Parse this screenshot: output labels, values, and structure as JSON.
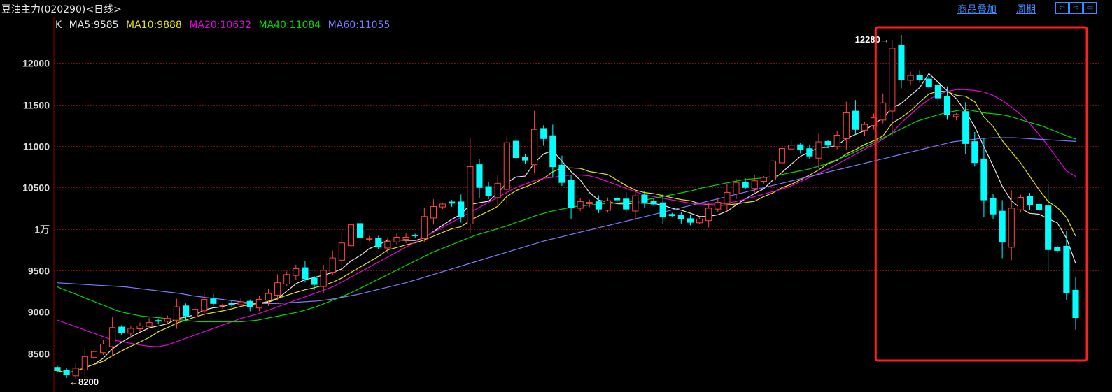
{
  "header": {
    "title": "豆油主力(020290)<日线>",
    "overlay_link": "商品叠加",
    "period_link": "周期",
    "ctrl_icons": [
      "arrow-left-icon",
      "arrow-right-icon",
      "window-icon"
    ],
    "ctrl_glyphs": [
      "⇦",
      "⇨",
      "▭"
    ]
  },
  "legend": [
    {
      "label": "K",
      "color": "#e0e0e0"
    },
    {
      "label": "MA5:9585",
      "color": "#e8e8e8"
    },
    {
      "label": "MA10:9888",
      "color": "#e6e600"
    },
    {
      "label": "MA20:10632",
      "color": "#e600e6"
    },
    {
      "label": "MA40:11084",
      "color": "#00d800"
    },
    {
      "label": "MA60:11055",
      "color": "#7b7bff"
    }
  ],
  "colors": {
    "up": "#ff4444",
    "down": "#00ffff",
    "grid": "#7a1010",
    "axis": "#8b0000",
    "highlight_box": "#ff2020"
  },
  "chart_data": {
    "type": "candlestick",
    "yticks": [
      {
        "value": 8500,
        "label": "8500"
      },
      {
        "value": 9000,
        "label": "9000"
      },
      {
        "value": 9500,
        "label": "9500"
      },
      {
        "value": 10000,
        "label": "1万"
      },
      {
        "value": 10500,
        "label": "10500"
      },
      {
        "value": 11000,
        "label": "11000"
      },
      {
        "value": 11500,
        "label": "11500"
      },
      {
        "value": 12000,
        "label": "12000"
      }
    ],
    "ylim": [
      8100,
      12500
    ],
    "annotations": [
      {
        "text": "12280→",
        "value": 12280,
        "bar": 91
      },
      {
        "text": "←8200",
        "value": 8200,
        "bar": 1
      }
    ],
    "highlight_range_bars": [
      90,
      111
    ],
    "closes": [
      8290,
      8240,
      8320,
      8460,
      8520,
      8610,
      8810,
      8750,
      8800,
      8830,
      8870,
      8890,
      8920,
      9060,
      8950,
      9030,
      9150,
      9100,
      9080,
      9090,
      9120,
      9060,
      9150,
      9220,
      9350,
      9450,
      9520,
      9400,
      9330,
      9500,
      9650,
      9830,
      10050,
      9900,
      9880,
      9780,
      9850,
      9900,
      9900,
      9920,
      10150,
      10270,
      10300,
      10310,
      10150,
      10750,
      10500,
      10400,
      10550,
      11040,
      10860,
      10830,
      11200,
      11090,
      10750,
      10560,
      10260,
      10330,
      10320,
      10240,
      10340,
      10350,
      10240,
      10400,
      10310,
      10300,
      10150,
      10160,
      10120,
      10080,
      10120,
      10250,
      10320,
      10440,
      10560,
      10500,
      10580,
      10620,
      10820,
      10970,
      11010,
      10960,
      10880,
      11050,
      11010,
      11130,
      11400,
      11200,
      11260,
      11340,
      11520,
      12180,
      11800,
      11850,
      11800,
      11720,
      11580,
      11380,
      11380,
      11030,
      10800,
      10350,
      10180,
      9840,
      10250,
      10380,
      10290,
      10230,
      9750,
      9740,
      9230,
      8930
    ],
    "series": [
      {
        "name": "MA5",
        "values": [
          8290,
          8265,
          8283,
          8328,
          8366,
          8440,
          8554,
          8632,
          8698,
          8754,
          8806,
          8830,
          8856,
          8916,
          8936,
          8964,
          9022,
          9048,
          9062,
          9094,
          9108,
          9102,
          9101,
          9116,
          9158,
          9248,
          9338,
          9388,
          9414,
          9444,
          9472,
          9518,
          9614,
          9678,
          9762,
          9808,
          9864,
          9868,
          9862,
          9860,
          9890,
          9968,
          10044,
          10116,
          10176,
          10296,
          10316,
          10334,
          10432,
          10556,
          10626,
          10636,
          10796,
          10904,
          10946,
          10818,
          10690,
          10588,
          10438,
          10346,
          10326,
          10304,
          10300,
          10316,
          10310,
          10306,
          10288,
          10250,
          10226,
          10190,
          10150,
          10152,
          10170,
          10214,
          10290,
          10362,
          10426,
          10484,
          10588,
          10682,
          10780,
          10876,
          10928,
          10982,
          10984,
          11006,
          11090,
          11138,
          11186,
          11266,
          11336,
          11460,
          11514,
          11610,
          11704,
          11874,
          11770,
          11666,
          11570,
          11416,
          11232,
          10994,
          10762,
          10514,
          10340,
          10248,
          10188,
          10178,
          10124,
          10074,
          9888,
          9584
        ]
      },
      {
        "name": "MA10",
        "values": [
          8290,
          8265,
          8283,
          8328,
          8366,
          8404,
          8470,
          8528,
          8584,
          8634,
          8690,
          8760,
          8810,
          8862,
          8900,
          8936,
          8970,
          8990,
          9010,
          9036,
          9066,
          9086,
          9102,
          9126,
          9162,
          9198,
          9234,
          9266,
          9290,
          9320,
          9356,
          9408,
          9476,
          9540,
          9604,
          9668,
          9746,
          9776,
          9808,
          9832,
          9868,
          9912,
          9958,
          10002,
          10026,
          10102,
          10162,
          10212,
          10274,
          10392,
          10462,
          10506,
          10550,
          10610,
          10688,
          10736,
          10736,
          10730,
          10692,
          10674,
          10656,
          10588,
          10522,
          10468,
          10438,
          10426,
          10402,
          10376,
          10354,
          10340,
          10306,
          10290,
          10284,
          10288,
          10302,
          10318,
          10334,
          10390,
          10434,
          10498,
          10538,
          10592,
          10650,
          10712,
          10786,
          10828,
          10904,
          10956,
          11018,
          11064,
          11120,
          11276,
          11342,
          11424,
          11528,
          11628,
          11662,
          11656,
          11612,
          11600,
          11534,
          11350,
          11236,
          11066,
          10930,
          10796,
          10634,
          10474,
          10330,
          10258,
          10140,
          9912
        ]
      },
      {
        "name": "MA20",
        "values": [
          8900,
          8860,
          8820,
          8780,
          8740,
          8700,
          8660,
          8640,
          8620,
          8600,
          8585,
          8580,
          8600,
          8640,
          8680,
          8720,
          8760,
          8800,
          8840,
          8880,
          8920,
          8950,
          8980,
          9020,
          9060,
          9100,
          9140,
          9180,
          9220,
          9260,
          9300,
          9360,
          9420,
          9480,
          9540,
          9600,
          9660,
          9720,
          9780,
          9840,
          9900,
          9960,
          10020,
          10080,
          10140,
          10200,
          10260,
          10320,
          10380,
          10440,
          10500,
          10540,
          10580,
          10610,
          10620,
          10640,
          10650,
          10650,
          10640,
          10610,
          10570,
          10530,
          10490,
          10450,
          10410,
          10390,
          10370,
          10350,
          10330,
          10310,
          10300,
          10300,
          10300,
          10310,
          10330,
          10360,
          10390,
          10420,
          10450,
          10480,
          10520,
          10570,
          10620,
          10670,
          10720,
          10780,
          10840,
          10900,
          10960,
          11020,
          11080,
          11160,
          11280,
          11380,
          11480,
          11560,
          11620,
          11660,
          11680,
          11680,
          11670,
          11650,
          11610,
          11550,
          11470,
          11380,
          11270,
          11140,
          11000,
          10850,
          10700,
          10632
        ]
      },
      {
        "name": "MA40",
        "values": [
          9300,
          9260,
          9220,
          9180,
          9140,
          9100,
          9060,
          9020,
          8990,
          8970,
          8950,
          8940,
          8930,
          8920,
          8910,
          8900,
          8890,
          8880,
          8880,
          8880,
          8880,
          8880,
          8880,
          8890,
          8900,
          8920,
          8940,
          8960,
          8980,
          9000,
          9030,
          9060,
          9100,
          9140,
          9180,
          9220,
          9270,
          9320,
          9370,
          9420,
          9470,
          9520,
          9570,
          9620,
          9670,
          9720,
          9760,
          9800,
          9840,
          9880,
          9920,
          9950,
          9980,
          10010,
          10040,
          10080,
          10110,
          10150,
          10180,
          10210,
          10230,
          10250,
          10270,
          10280,
          10290,
          10300,
          10310,
          10310,
          10320,
          10330,
          10340,
          10360,
          10380,
          10400,
          10420,
          10440,
          10460,
          10490,
          10510,
          10530,
          10550,
          10570,
          10590,
          10600,
          10610,
          10620,
          10640,
          10660,
          10680,
          10700,
          10720,
          10750,
          10780,
          10820,
          10860,
          10900,
          10950,
          11000,
          11050,
          11100,
          11150,
          11200,
          11250,
          11300,
          11330,
          11360,
          11390,
          11410,
          11430,
          11440,
          11420,
          11400,
          11390,
          11380,
          11360,
          11330,
          11300,
          11270,
          11240,
          11200,
          11160,
          11120,
          11084
        ]
      },
      {
        "name": "MA60",
        "values": [
          9350,
          9345,
          9340,
          9335,
          9330,
          9325,
          9320,
          9315,
          9310,
          9305,
          9300,
          9290,
          9280,
          9270,
          9260,
          9250,
          9240,
          9230,
          9220,
          9205,
          9190,
          9180,
          9170,
          9160,
          9150,
          9140,
          9130,
          9120,
          9110,
          9105,
          9100,
          9100,
          9100,
          9105,
          9110,
          9115,
          9120,
          9125,
          9130,
          9140,
          9150,
          9165,
          9180,
          9195,
          9210,
          9230,
          9250,
          9270,
          9290,
          9310,
          9330,
          9350,
          9375,
          9400,
          9425,
          9450,
          9475,
          9500,
          9525,
          9550,
          9575,
          9600,
          9625,
          9650,
          9675,
          9700,
          9725,
          9750,
          9775,
          9800,
          9825,
          9850,
          9870,
          9890,
          9910,
          9930,
          9950,
          9970,
          9990,
          10010,
          10030,
          10050,
          10070,
          10090,
          10110,
          10130,
          10150,
          10170,
          10190,
          10210,
          10230,
          10250,
          10270,
          10290,
          10310,
          10330,
          10350,
          10370,
          10390,
          10410,
          10430,
          10450,
          10470,
          10490,
          10510,
          10530,
          10550,
          10570,
          10590,
          10610,
          10630,
          10650,
          10670,
          10690,
          10710,
          10730,
          10750,
          10770,
          10790,
          10810,
          10830,
          10850,
          10870,
          10890,
          10910,
          10930,
          10950,
          10970,
          10990,
          11010,
          11030,
          11050,
          11060,
          11070,
          11080,
          11090,
          11095,
          11100,
          11100,
          11100,
          11100,
          11095,
          11090,
          11085,
          11080,
          11075,
          11070,
          11065,
          11060,
          11055
        ]
      }
    ]
  }
}
